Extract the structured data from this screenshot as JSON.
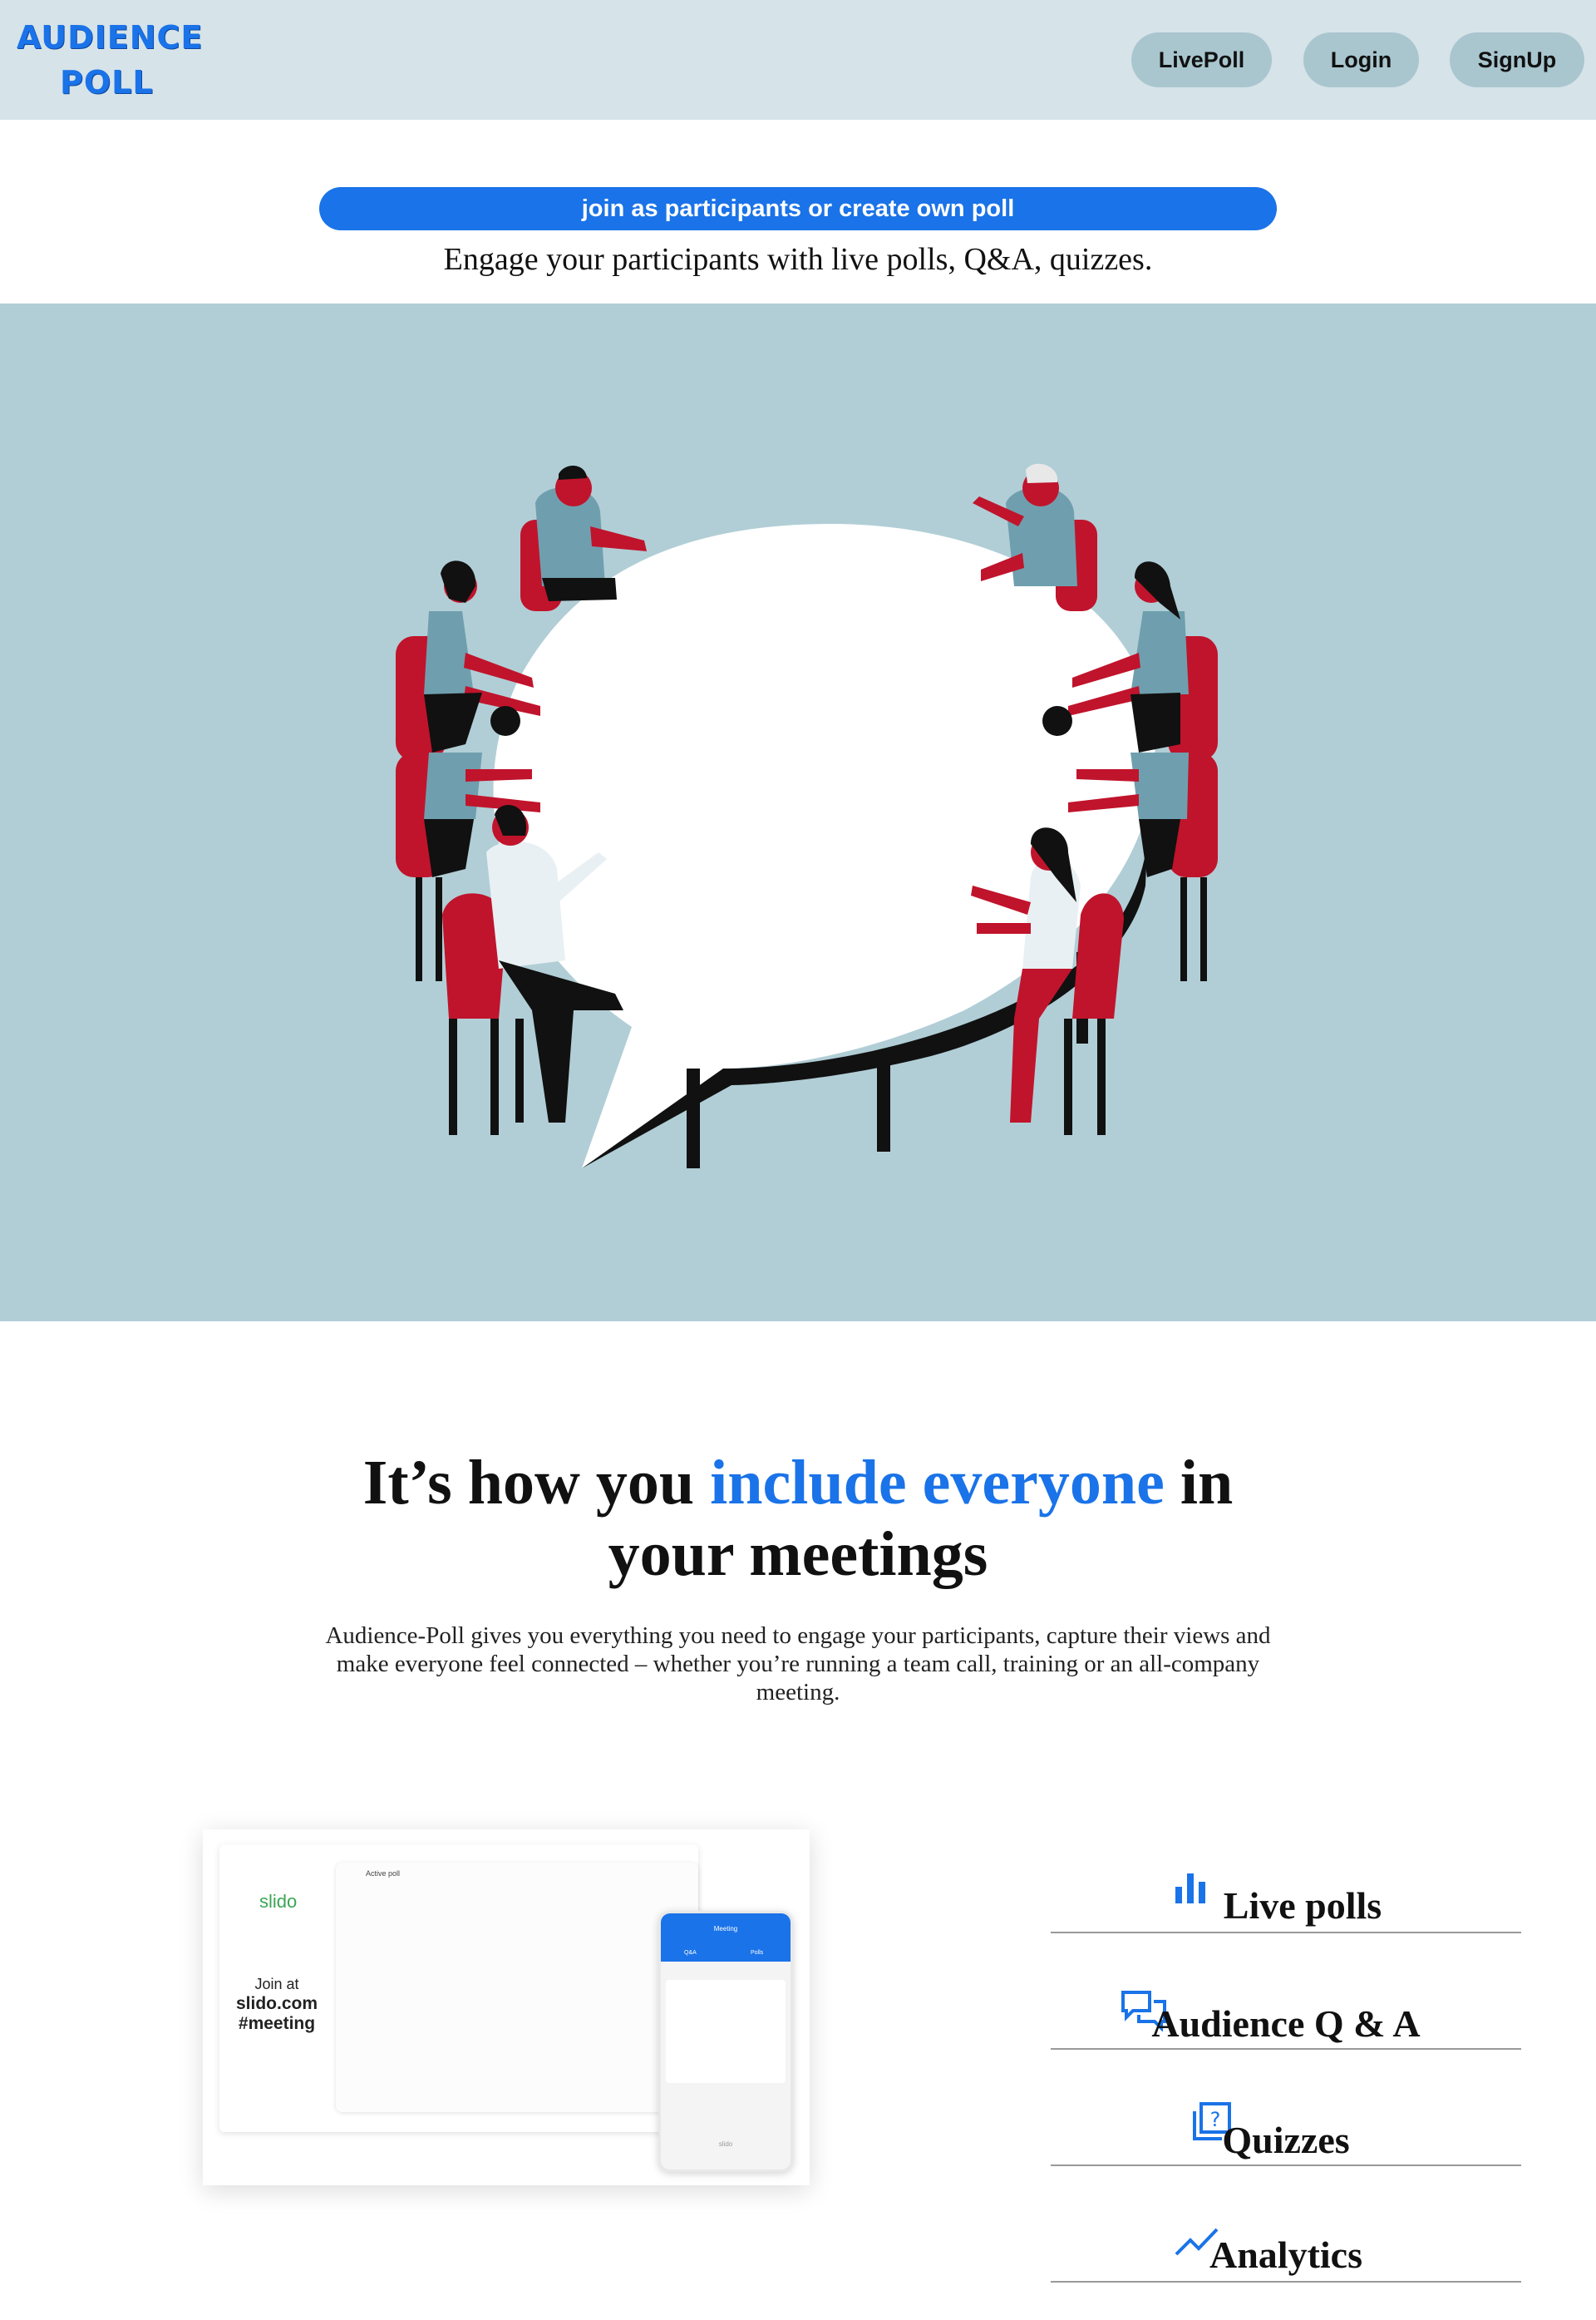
{
  "header": {
    "logo_line1": "AUDIENCE",
    "logo_line2": "POLL",
    "nav": [
      {
        "label": "LivePoll"
      },
      {
        "label": "Login"
      },
      {
        "label": "SignUp"
      }
    ]
  },
  "intro": {
    "cta_label": "join as participants or create own poll",
    "tagline": "Engage your participants with live polls, Q&A, quizzes."
  },
  "section": {
    "headline_part1": "It’s how you ",
    "headline_highlight": "include everyone",
    "headline_part2": " in your meetings",
    "description": "Audience-Poll gives you everything you need to engage your participants, capture their views and make everyone feel connected – whether you’re running a team call, training or an all-company meeting."
  },
  "mockup": {
    "brand": "slido",
    "join_text": "Join at",
    "join_url": "slido.com",
    "join_code": "#meeting",
    "active_label": "Active poll",
    "phone_title": "Meeting",
    "phone_tab_qa": "Q&A",
    "phone_tab_polls": "Polls",
    "phone_footer": "slido"
  },
  "features": [
    {
      "label": "Live polls",
      "icon": "bar-chart-icon"
    },
    {
      "label": "Audience Q & A",
      "icon": "chat-bubbles-icon"
    },
    {
      "label": "Quizzes",
      "icon": "quiz-icon"
    },
    {
      "label": "Analytics",
      "icon": "trend-line-icon"
    }
  ],
  "colors": {
    "header_bg": "#d6e3e8",
    "accent": "#1a73e8",
    "nav_button": "#a9c6cf",
    "hero_bg": "#b1ced6",
    "figure_red": "#c0142c",
    "figure_blue": "#6f9fae"
  }
}
